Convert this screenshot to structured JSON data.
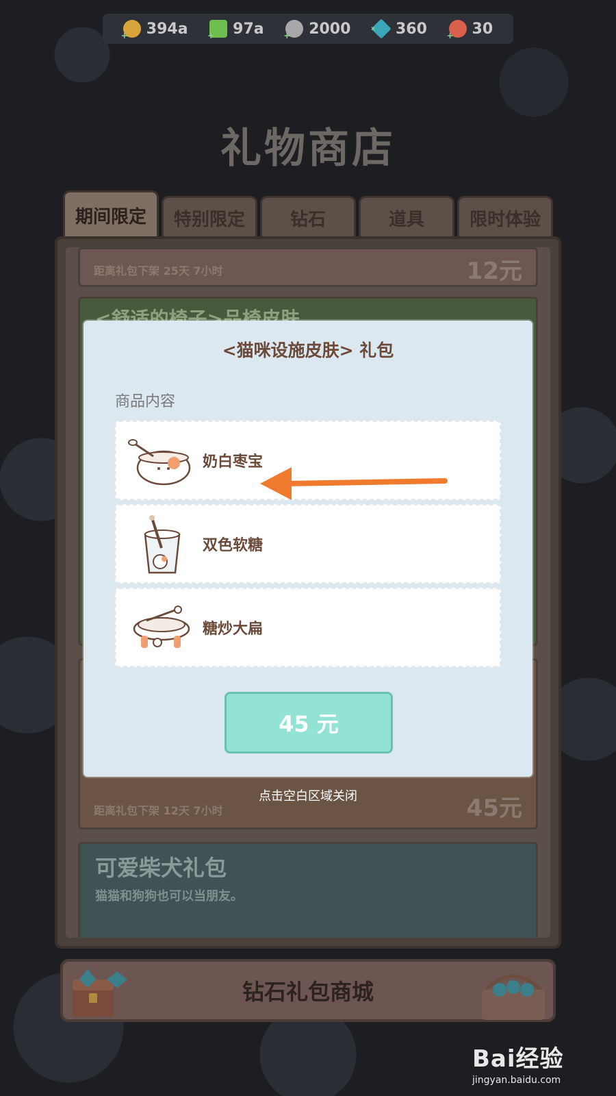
{
  "currency": [
    {
      "icon": "coin-icon",
      "value": "394a",
      "color": "#d9a43a"
    },
    {
      "icon": "lightning-icon",
      "value": "97a",
      "color": "#6fbf4f"
    },
    {
      "icon": "coin-stack-icon",
      "value": "2000",
      "color": "#a8a8a8"
    },
    {
      "icon": "diamond-icon",
      "value": "360",
      "color": "#3aa6b8"
    },
    {
      "icon": "ticket-icon",
      "value": "30",
      "color": "#d9604a"
    }
  ],
  "shop": {
    "title": "礼物商店",
    "tabs": [
      "期间限定",
      "特别限定",
      "钻石",
      "道具",
      "限时体验"
    ],
    "active_tab": 0,
    "cards": {
      "a": {
        "timer": "距离礼包下架 25天 7小时",
        "price": "12元"
      },
      "b": {
        "title": "<舒适的椅子>品椅皮肤"
      },
      "c": {
        "timer": "距离礼包下架 12天 7小时",
        "price": "45元"
      },
      "d": {
        "title": "可爱柴犬礼包",
        "subtitle": "猫猫和狗狗也可以当朋友。"
      }
    },
    "diamond_mall_label": "钻石礼包商城"
  },
  "modal": {
    "title": "<猫咪设施皮肤> 礼包",
    "contents_label": "商品内容",
    "items": [
      {
        "name": "奶白枣宝",
        "icon": "cat-cup-icon"
      },
      {
        "name": "双色软糖",
        "icon": "cat-glass-icon"
      },
      {
        "name": "糖炒大扁",
        "icon": "cat-bowl-icon"
      }
    ],
    "buy_label": "45 元",
    "close_hint": "点击空白区域关闭"
  },
  "annotation": {
    "arrow_color": "#f07a2e"
  },
  "watermark": {
    "logo": "Bai经验",
    "url": "jingyan.baidu.com"
  }
}
